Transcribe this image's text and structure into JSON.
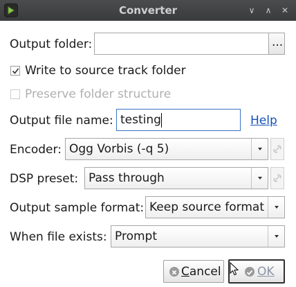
{
  "window": {
    "title": "Converter"
  },
  "output_folder": {
    "label": "Output folder:",
    "value": "",
    "browse_label": "..."
  },
  "write_to_source": {
    "label": "Write to source track folder",
    "checked": true
  },
  "preserve_structure": {
    "label": "Preserve folder structure",
    "checked": false,
    "enabled": false
  },
  "output_file_name": {
    "label": "Output file name:",
    "value": "testing",
    "help_label": "Help"
  },
  "encoder": {
    "label": "Encoder:",
    "value": "Ogg Vorbis (-q 5)"
  },
  "dsp_preset": {
    "label": "DSP preset:",
    "value": "Pass through"
  },
  "sample_format": {
    "label": "Output sample format:",
    "value": "Keep source format"
  },
  "file_exists": {
    "label": "When file exists:",
    "value": "Prompt"
  },
  "buttons": {
    "cancel_mnemonic": "C",
    "cancel_rest": "ancel",
    "ok_mnemonic": "O",
    "ok_rest": "K"
  },
  "colors": {
    "titlebar": "#3f4142",
    "link": "#1550b8",
    "focus": "#3874c4"
  }
}
